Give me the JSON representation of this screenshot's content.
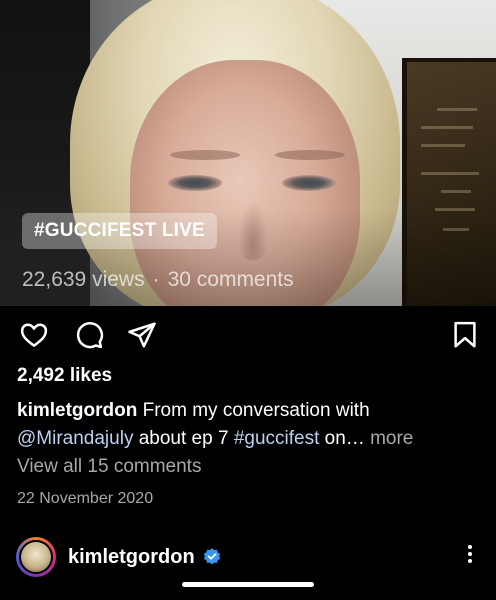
{
  "post": {
    "hashtag_overlay": "#GUCCIFEST LIVE",
    "views": "22,639 views",
    "separator": "·",
    "comments": "30 comments",
    "likes": "2,492 likes",
    "caption": {
      "username": "kimletgordon",
      "text_1": "From my conversation with",
      "mention": "@Mirandajuly",
      "text_2": "about ep 7",
      "hashtag": "#guccifest",
      "text_3": "on…",
      "more": "more"
    },
    "view_all_comments": "View all 15 comments",
    "date": "22 November 2020"
  },
  "next_post": {
    "username": "kimletgordon",
    "verified": true
  },
  "icons": {
    "like": "heart-icon",
    "comment": "comment-bubble-icon",
    "share": "send-icon",
    "save": "bookmark-icon",
    "verified": "verified-badge-icon",
    "options": "more-vertical-icon"
  },
  "colors": {
    "background": "#000000",
    "link": "#bcd0f2",
    "muted": "#a8a8a8",
    "verified": "#3797f0"
  }
}
